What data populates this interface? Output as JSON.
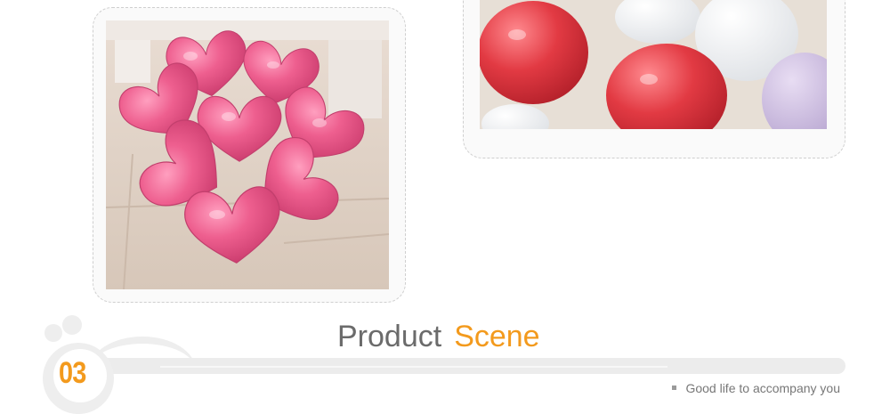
{
  "section": {
    "number": "03",
    "title_main": "Product",
    "title_accent": "Scene",
    "tagline": "Good life to accompany you"
  },
  "photos": [
    {
      "name": "heart-balloons-flower-photo"
    },
    {
      "name": "heart-balloons-floor-photo"
    }
  ],
  "colors": {
    "accent": "#f39a1d",
    "title_gray": "#6b6b6b",
    "balloon_pink": "#ec5a8a",
    "balloon_red": "#e23a43"
  }
}
